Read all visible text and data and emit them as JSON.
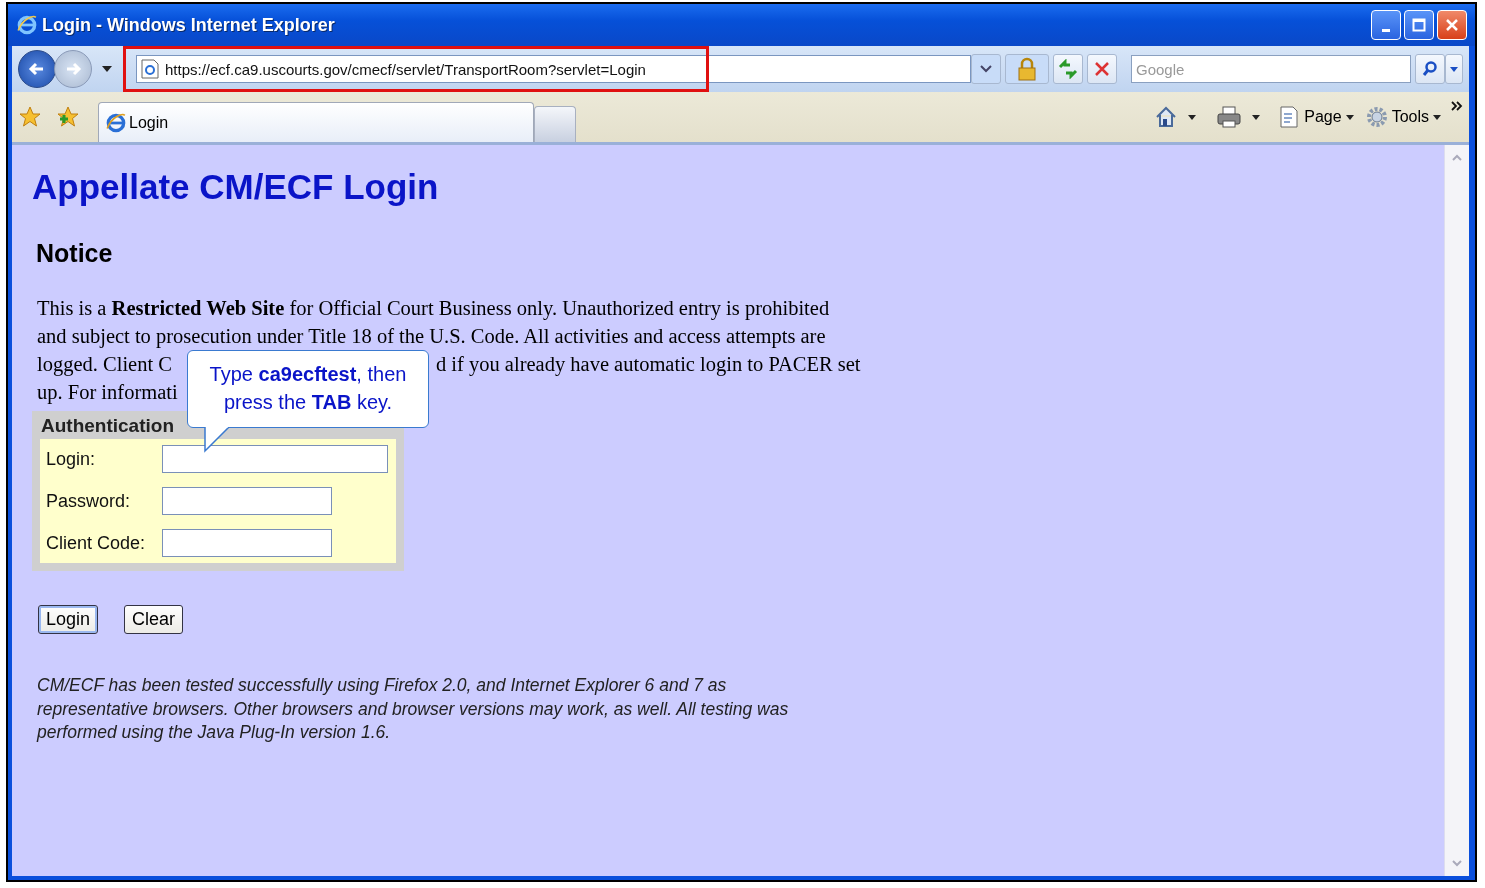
{
  "window": {
    "title": "Login - Windows Internet Explorer"
  },
  "address_bar": {
    "url": "https://ecf.ca9.uscourts.gov/cmecf/servlet/TransportRoom?servlet=Login",
    "highlighted": true
  },
  "search": {
    "placeholder": "Google"
  },
  "tabs": [
    {
      "label": "Login",
      "selected": true
    }
  ],
  "command_bar": [
    {
      "kind": "home"
    },
    {
      "kind": "print"
    },
    {
      "kind": "page",
      "label": "Page"
    },
    {
      "kind": "tools",
      "label": "Tools"
    }
  ],
  "page": {
    "heading": "Appellate CM/ECF Login",
    "notice_heading": "Notice",
    "notice_lines": [
      {
        "parts": [
          "This is a **Restricted Web Site** for Official Court Business only. Unauthorized entry is prohibited"
        ]
      },
      {
        "parts": [
          "and subject to prosecution under Title 18 of the U.S. Code. All activities and access attempts are"
        ]
      },
      {
        "parts": [
          "logged. Client C",
          "d if you already have automatic login to PACER set"
        ]
      },
      {
        "parts": [
          "up. For informati"
        ]
      }
    ],
    "callout": {
      "lines": [
        "Type **ca9ecftest**, then",
        "press the **TAB** key."
      ]
    },
    "auth": {
      "title": "Authentication",
      "fields": [
        {
          "label": "Login:",
          "kind": "wide"
        },
        {
          "label": "Password:",
          "kind": "normal"
        },
        {
          "label": "Client Code:",
          "kind": "normal"
        }
      ]
    },
    "buttons": [
      {
        "label": "Login",
        "focused": true
      },
      {
        "label": "Clear",
        "focused": false
      }
    ],
    "footer_note": "CM/ECF has been tested successfully using Firefox 2.0, and Internet Explorer 6 and 7 as representative browsers. Other browsers and browser versions may work, as well. All testing was performed using the Java Plug-In version 1.6."
  }
}
